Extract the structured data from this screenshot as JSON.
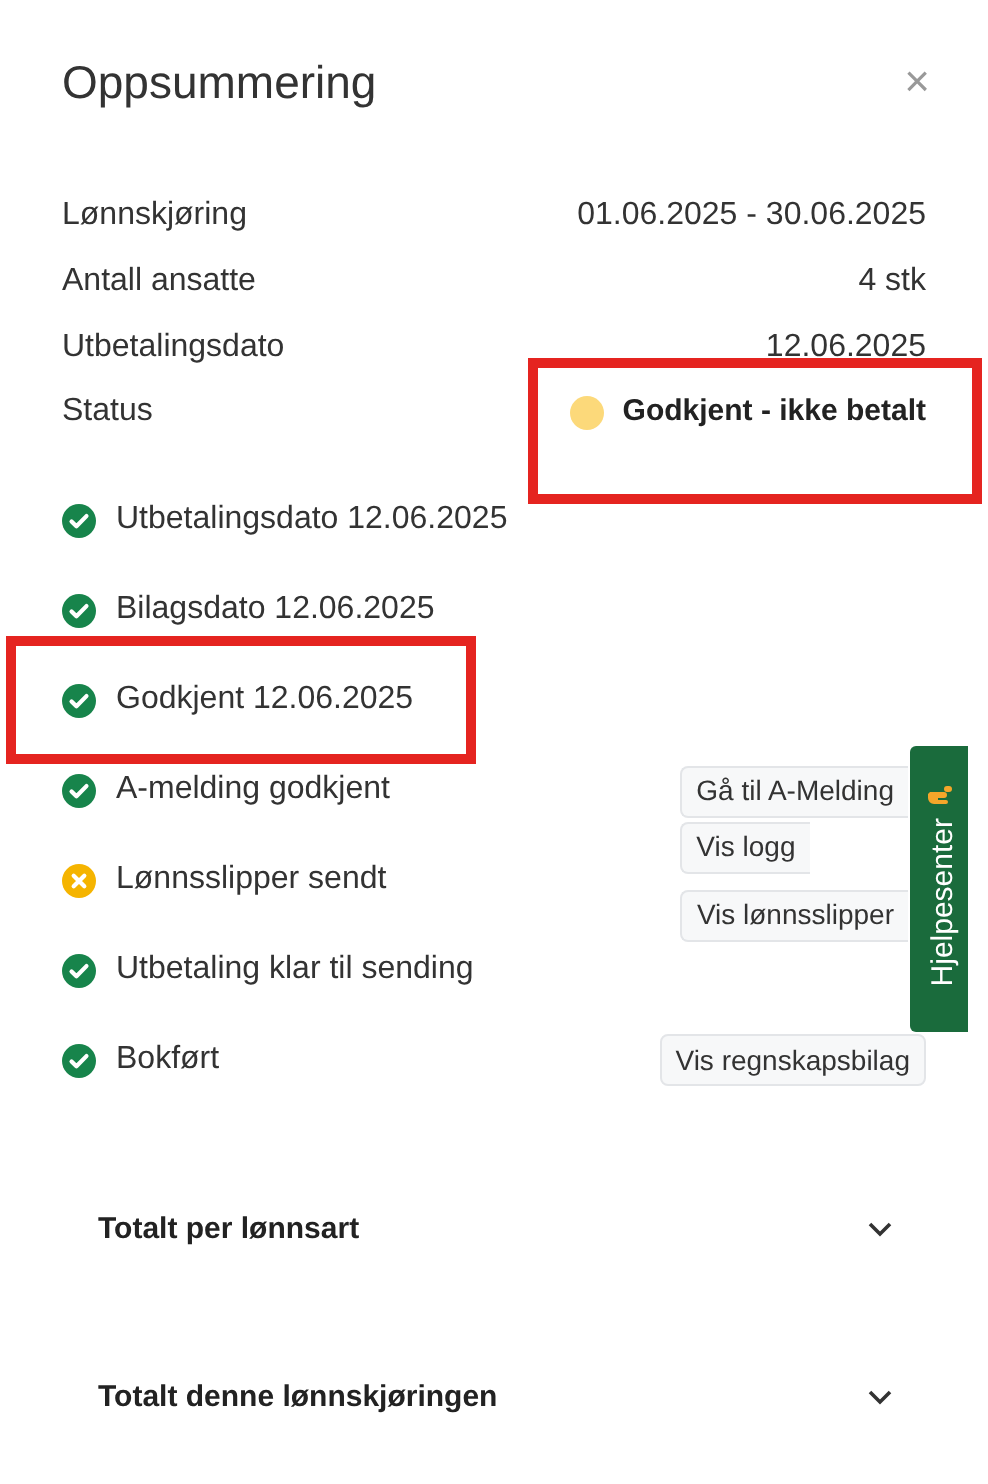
{
  "title": "Oppsummering",
  "close": "×",
  "summary": [
    {
      "label": "Lønnskjøring",
      "value": "01.06.2025 - 30.06.2025",
      "kind": "text",
      "highlighted": false
    },
    {
      "label": "Antall ansatte",
      "value": "4 stk",
      "kind": "text",
      "highlighted": false
    },
    {
      "label": "Utbetalingsdato",
      "value": "12.06.2025",
      "kind": "text",
      "highlighted": false
    },
    {
      "label": "Status",
      "value": "Godkjent - ikke betalt",
      "kind": "status",
      "color": "#fcd97a",
      "highlighted": true
    }
  ],
  "steps": [
    {
      "label": "Utbetalingsdato 12.06.2025",
      "done": true,
      "highlighted": false
    },
    {
      "label": "Bilagsdato 12.06.2025",
      "done": true,
      "highlighted": false
    },
    {
      "label": "Godkjent 12.06.2025",
      "done": true,
      "highlighted": true
    },
    {
      "label": "A-melding godkjent",
      "done": true,
      "highlighted": false,
      "buttons": [
        "Gå til A-Melding",
        "Vis logg"
      ]
    },
    {
      "label": "Lønnsslipper sendt",
      "done": false,
      "highlighted": false,
      "buttons": [
        "Vis lønnsslipper"
      ]
    },
    {
      "label": "Utbetaling klar til sending",
      "done": true,
      "highlighted": false
    },
    {
      "label": "Bokført",
      "done": true,
      "highlighted": false,
      "buttons": [
        "Vis regnskapsbilag"
      ]
    }
  ],
  "sections": [
    {
      "title": "Totalt per lønnsart",
      "expanded": false
    },
    {
      "title": "Totalt denne lønnskjøringen",
      "expanded": false
    }
  ],
  "help_tab": {
    "label": "Hjelpesenter"
  }
}
